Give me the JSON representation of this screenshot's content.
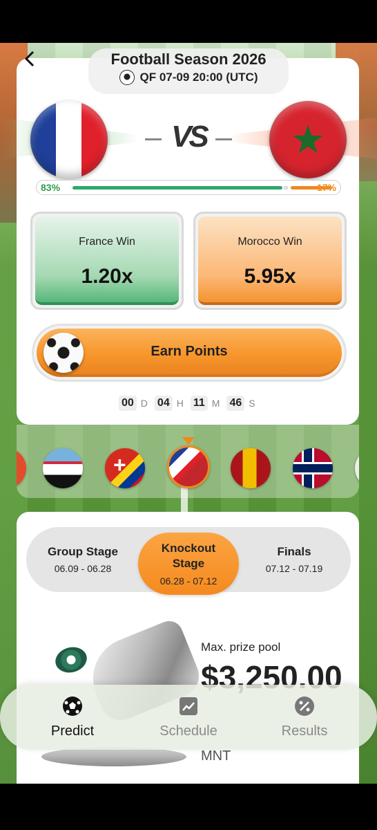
{
  "header": {
    "title": "Football Season 2026",
    "subtitle": "QF 07-09 20:00 (UTC)"
  },
  "match": {
    "team_a": "France",
    "team_b": "Morocco",
    "vs_label": "VS",
    "team_a_pct": "83%",
    "team_b_pct": "17%",
    "team_a_share": 0.83,
    "team_b_share": 0.17
  },
  "bets": [
    {
      "label": "France Win",
      "odds": "1.20x",
      "color": "#56b77a"
    },
    {
      "label": "Morocco Win",
      "odds": "5.95x",
      "color": "#f4932f"
    }
  ],
  "earn_button": {
    "label": "Earn Points"
  },
  "countdown": {
    "days": "00",
    "days_unit": "D",
    "hours": "04",
    "hours_unit": "H",
    "minutes": "11",
    "minutes_unit": "M",
    "seconds": "46",
    "seconds_unit": "S"
  },
  "match_carousel": {
    "items": [
      "argentina-egypt-flag",
      "switzerland-colombia-flag",
      "france-morocco-flag",
      "spain-belgium-flag",
      "norway-denmark-flag"
    ],
    "active_index": 2
  },
  "stages": [
    {
      "name": "Group Stage",
      "dates": "06.09 - 06.28",
      "active": false
    },
    {
      "name": "Knockout Stage",
      "dates": "06.28 - 07.12",
      "active": true
    },
    {
      "name": "Finals",
      "dates": "07.12 - 07.19",
      "active": false
    }
  ],
  "prize": {
    "label": "Max. prize pool",
    "value": "$3,250.00",
    "unit": "MNT"
  },
  "bottom_nav": [
    {
      "label": "Predict",
      "icon": "soccer-ball-icon",
      "active": true
    },
    {
      "label": "Schedule",
      "icon": "chart-icon",
      "active": false
    },
    {
      "label": "Results",
      "icon": "percent-icon",
      "active": false
    }
  ],
  "colors": {
    "accent_orange": "#f0881f",
    "accent_green": "#2ea86b"
  }
}
